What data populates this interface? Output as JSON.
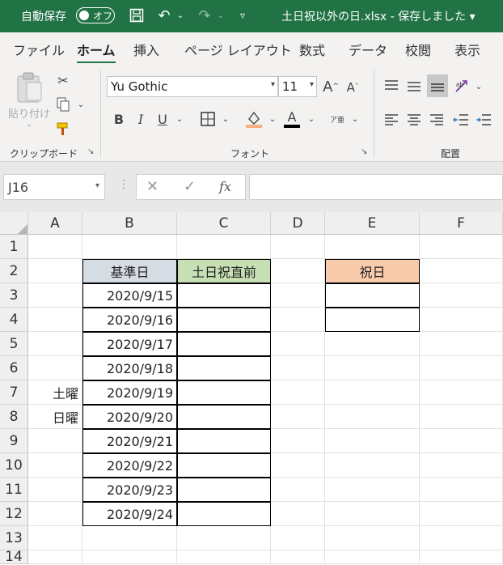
{
  "titlebar": {
    "autosave_label": "自動保存",
    "autosave_state": "オフ",
    "doc_title": "土日祝以外の日.xlsx - 保存しました ▾"
  },
  "tabs": [
    "ファイル",
    "ホーム",
    "挿入",
    "ページ レイアウト",
    "数式",
    "データ",
    "校閲",
    "表示"
  ],
  "active_tab": "ホーム",
  "ribbon": {
    "paste_label": "貼り付け",
    "clipboard_group": "クリップボード",
    "font_name": "Yu Gothic",
    "font_size": "11",
    "font_group": "フォント",
    "alignment_group": "配置",
    "bold": "B",
    "italic": "I",
    "underline": "U",
    "phonetic": "ア亜",
    "grow_font": "A",
    "shrink_font": "A",
    "font_color_letter": "A",
    "font_color": "#c00000",
    "fill_color": "#f4b183"
  },
  "formula_bar": {
    "name_box": "J16",
    "fx": "fx",
    "formula": ""
  },
  "columns": [
    "A",
    "B",
    "C",
    "D",
    "E",
    "F"
  ],
  "rows": [
    "1",
    "2",
    "3",
    "4",
    "5",
    "6",
    "7",
    "8",
    "9",
    "10",
    "11",
    "12",
    "13",
    "14"
  ],
  "cells": {
    "B2": "基準日",
    "C2": "土日祝直前",
    "E2": "祝日",
    "B3": "2020/9/15",
    "B4": "2020/9/16",
    "B5": "2020/9/17",
    "B6": "2020/9/18",
    "B7": "2020/9/19",
    "B8": "2020/9/20",
    "B9": "2020/9/21",
    "B10": "2020/9/22",
    "B11": "2020/9/23",
    "B12": "2020/9/24",
    "A7": "土曜",
    "A8": "日曜"
  },
  "colors": {
    "brand": "#217346",
    "b2_fill": "#d6dce4",
    "c2_fill": "#c6e0b4",
    "e2_fill": "#f8cbad"
  }
}
